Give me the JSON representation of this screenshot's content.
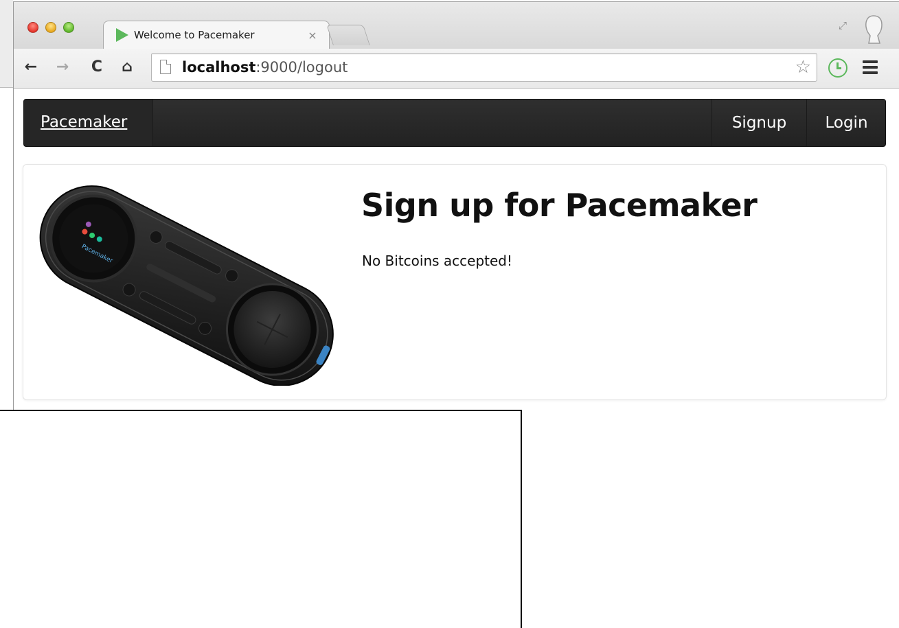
{
  "browser": {
    "tab": {
      "title": "Welcome to Pacemaker",
      "close_glyph": "×"
    },
    "toolbar": {
      "back_glyph": "←",
      "forward_glyph": "→",
      "reload_glyph": "C",
      "home_glyph": "⌂",
      "star_glyph": "☆",
      "resize_glyph": "⤢"
    },
    "url": {
      "host": "localhost",
      "rest": ":9000/logout"
    },
    "icons": [
      "close-window-icon",
      "minimize-window-icon",
      "maximize-window-icon",
      "page-icon",
      "star-icon",
      "history-icon",
      "menu-icon",
      "profile-icon"
    ],
    "colors": {
      "favicon": "#5cb85c",
      "history_icon": "#5cb85c"
    }
  },
  "navbar": {
    "brand": "Pacemaker",
    "links": [
      "Signup",
      "Login"
    ],
    "background": "#262626"
  },
  "hero": {
    "title": "Sign up for Pacemaker",
    "text": "No Bitcoins accepted!",
    "device_logo_text": "Pacemaker"
  }
}
